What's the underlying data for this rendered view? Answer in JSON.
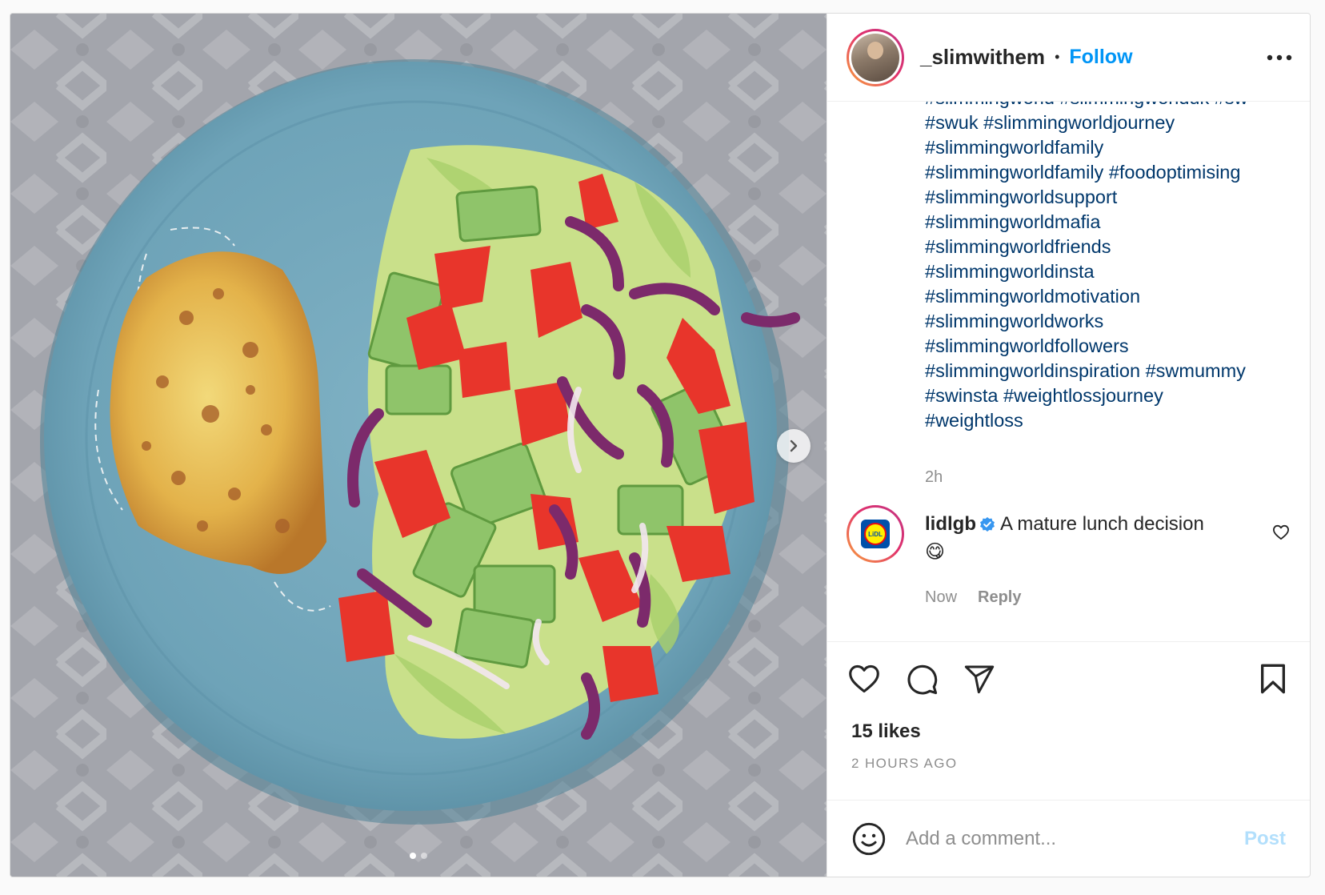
{
  "post": {
    "username": "_slimwithem",
    "separator": "•",
    "follow_label": "Follow",
    "more_icon": "more-horizontal-icon",
    "caption_lines": [
      "#slimmingworld #slimmingworlduk #sw",
      "#swuk #slimmingworldjourney",
      "#slimmingworldfamily",
      "#slimmingworldfamily #foodoptimising",
      "#slimmingworldsupport",
      "#slimmingworldmafia",
      "#slimmingworldfriends",
      "#slimmingworldinsta",
      "#slimmingworldmotivation",
      "#slimmingworldworks",
      "#slimmingworldfollowers",
      "#slimmingworldinspiration #swmummy",
      "#swinsta #weightlossjourney",
      "#weightloss"
    ],
    "caption_time": "2h",
    "carousel": {
      "current": 1,
      "total": 2
    }
  },
  "comment": {
    "username": "lidlgb",
    "verified": true,
    "text": "A mature lunch decision",
    "emoji": "😋",
    "time": "Now",
    "reply_label": "Reply",
    "avatar_text": "LiDL"
  },
  "actions": {
    "likes": "15 likes",
    "ago": "2 HOURS AGO"
  },
  "add_comment": {
    "placeholder": "Add a comment...",
    "post_label": "Post"
  },
  "colors": {
    "link": "#00376b",
    "accent": "#0095f6",
    "post_disabled": "#b2dffc",
    "muted": "#8e8e8e"
  }
}
